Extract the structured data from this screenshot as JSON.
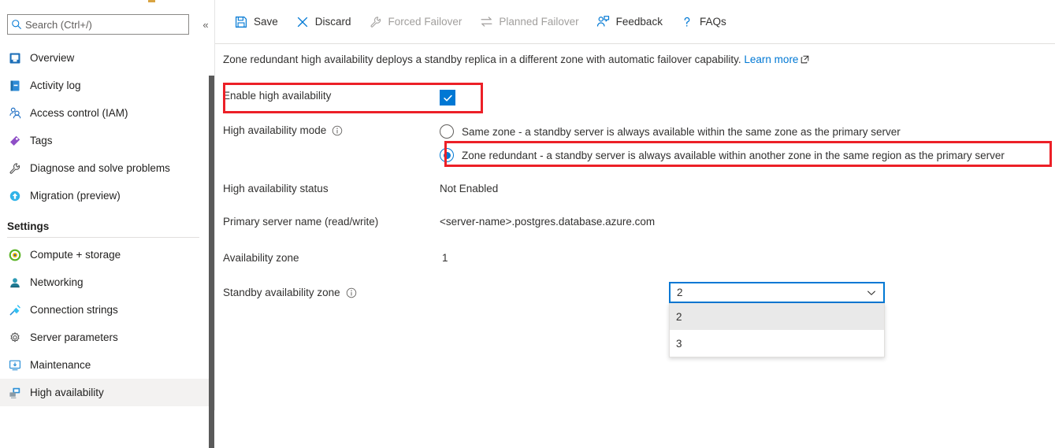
{
  "sidebar": {
    "search": {
      "placeholder": "Search (Ctrl+/)",
      "value": "",
      "icon": "search-icon"
    },
    "collapse_glyph": "«",
    "items": [
      {
        "label": "Overview",
        "icon": "overview-icon",
        "selected": false
      },
      {
        "label": "Activity log",
        "icon": "activity-log-icon",
        "selected": false
      },
      {
        "label": "Access control (IAM)",
        "icon": "access-control-icon",
        "selected": false
      },
      {
        "label": "Tags",
        "icon": "tags-icon",
        "selected": false
      },
      {
        "label": "Diagnose and solve problems",
        "icon": "wrench-icon",
        "selected": false
      },
      {
        "label": "Migration (preview)",
        "icon": "migration-icon",
        "selected": false
      }
    ],
    "group_title": "Settings",
    "settings_items": [
      {
        "label": "Compute + storage",
        "icon": "compute-storage-icon",
        "selected": false
      },
      {
        "label": "Networking",
        "icon": "networking-icon",
        "selected": false
      },
      {
        "label": "Connection strings",
        "icon": "connection-strings-icon",
        "selected": false
      },
      {
        "label": "Server parameters",
        "icon": "server-parameters-icon",
        "selected": false
      },
      {
        "label": "Maintenance",
        "icon": "maintenance-icon",
        "selected": false
      },
      {
        "label": "High availability",
        "icon": "high-availability-icon",
        "selected": true
      }
    ]
  },
  "toolbar": {
    "buttons": [
      {
        "label": "Save",
        "icon": "save-icon",
        "disabled": false
      },
      {
        "label": "Discard",
        "icon": "discard-icon",
        "disabled": false
      },
      {
        "label": "Forced Failover",
        "icon": "wrench-icon",
        "disabled": true
      },
      {
        "label": "Planned Failover",
        "icon": "swap-arrows-icon",
        "disabled": true
      },
      {
        "label": "Feedback",
        "icon": "feedback-icon",
        "disabled": false
      },
      {
        "label": "FAQs",
        "icon": "question-mark-icon",
        "disabled": false
      }
    ]
  },
  "main": {
    "description": "Zone redundant high availability deploys a standby replica in a different zone with automatic failover capability.",
    "learn_more": "Learn more",
    "enable_ha": {
      "label": "Enable high availability",
      "checked": true
    },
    "ha_mode": {
      "label": "High availability mode",
      "options": [
        {
          "label": "Same zone - a standby server is always available within the same zone as the primary server",
          "selected": false
        },
        {
          "label": "Zone redundant - a standby server is always available within another zone in the same region as the primary server",
          "selected": true
        }
      ]
    },
    "ha_status": {
      "label": "High availability status",
      "value": "Not Enabled"
    },
    "primary_server": {
      "label": "Primary server name (read/write)",
      "value": "<server-name>.postgres.database.azure.com"
    },
    "availability_zone": {
      "label": "Availability zone",
      "value": "1"
    },
    "standby_zone": {
      "label": "Standby availability zone",
      "value": "2",
      "options": [
        "2",
        "3"
      ],
      "selected_option": "2",
      "expanded": true
    }
  },
  "colors": {
    "accent": "#0078d4",
    "annotation": "#ec2027",
    "selected_row": "#f3f2f1",
    "disabled_text": "#a19f9d"
  }
}
